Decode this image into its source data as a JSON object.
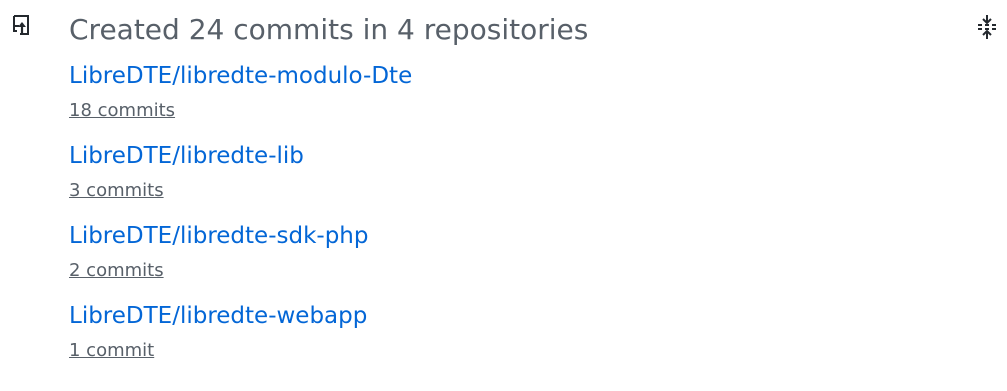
{
  "activity": {
    "icon": "repo-push-icon",
    "title": "Created 24 commits in 4 repositories",
    "toggle_icon": "unfold-icon",
    "repositories": [
      {
        "name": "LibreDTE/libredte-modulo-Dte",
        "commits": "18 commits"
      },
      {
        "name": "LibreDTE/libredte-lib",
        "commits": "3 commits"
      },
      {
        "name": "LibreDTE/libredte-sdk-php",
        "commits": "2 commits"
      },
      {
        "name": "LibreDTE/libredte-webapp",
        "commits": "1 commit"
      }
    ]
  },
  "colors": {
    "text_muted": "#586069",
    "link": "#0366d6",
    "icon": "#24292e"
  }
}
